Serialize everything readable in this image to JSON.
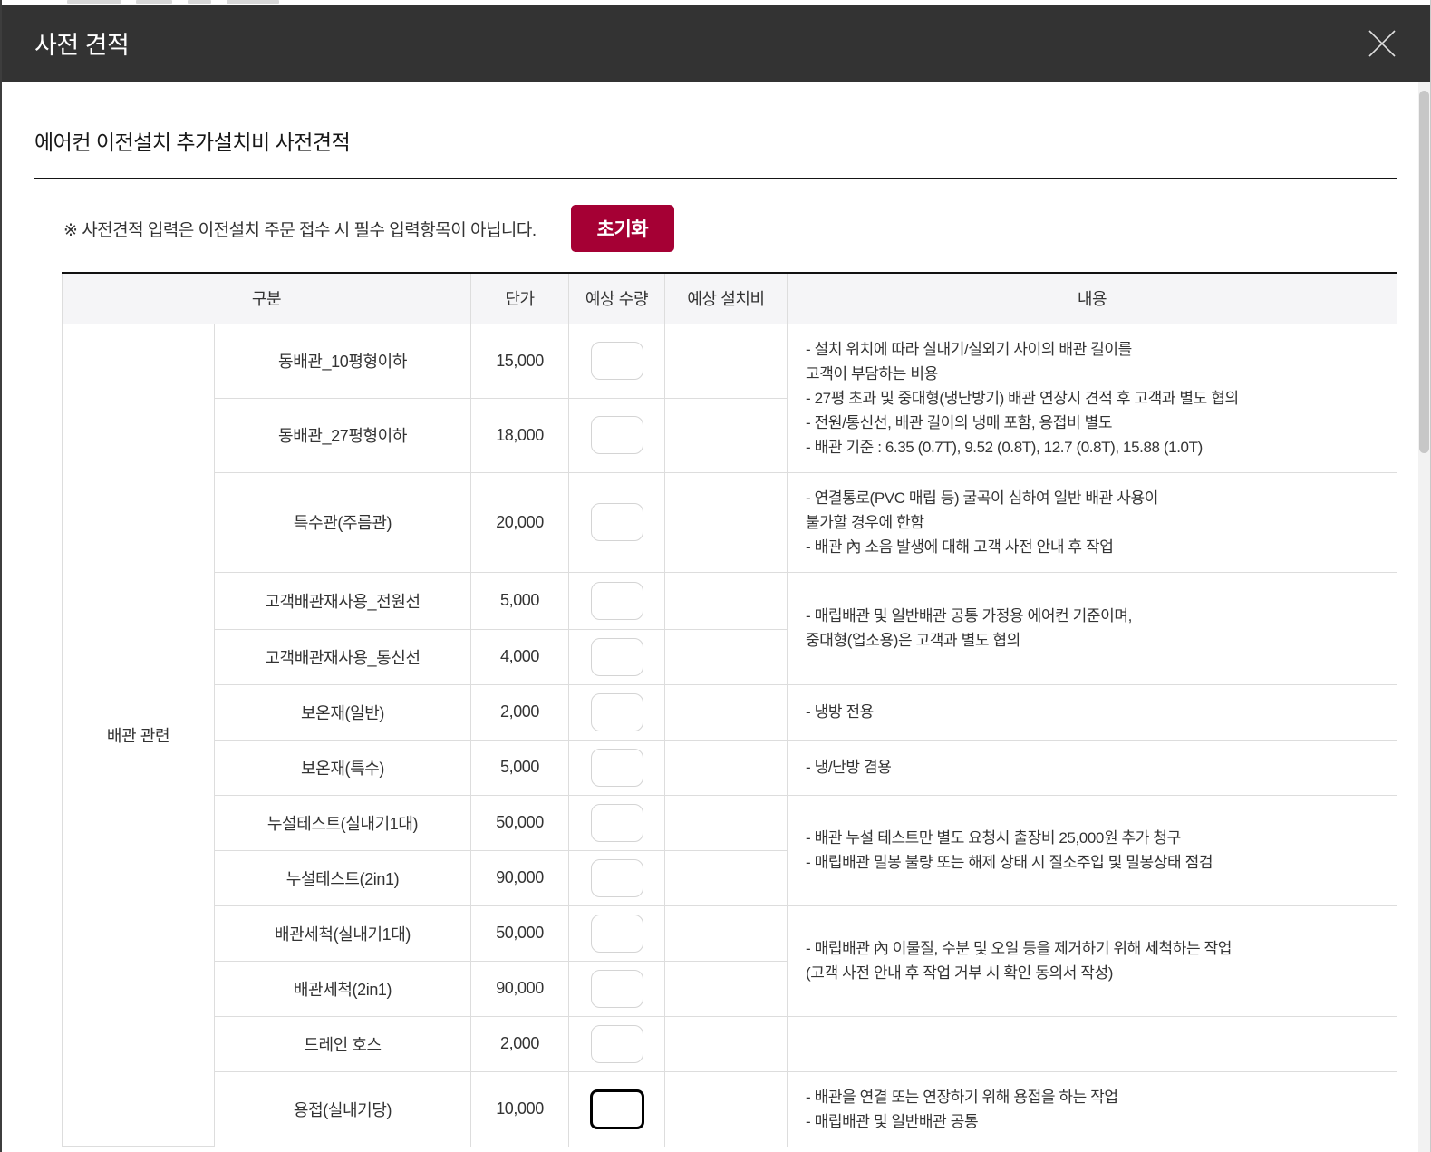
{
  "modal": {
    "title": "사전 견적",
    "close_icon": "x-icon"
  },
  "content": {
    "section_title": "에어컨 이전설치 추가설치비 사전견적",
    "note": "※ 사전견적 입력은 이전설치 주문 접수 시 필수 입력항목이 아닙니다.",
    "reset_button_label": "초기화"
  },
  "table": {
    "headers": {
      "category": "구분",
      "unit_price": "단가",
      "expected_quantity": "예상 수량",
      "expected_install_cost": "예상 설치비",
      "details": "내용"
    },
    "group_label": "배관 관련",
    "rows": [
      {
        "item": "동배관_10평형이하",
        "unit_price": "15,000",
        "quantity": "",
        "install_cost": ""
      },
      {
        "item": "동배관_27평형이하",
        "unit_price": "18,000",
        "quantity": "",
        "install_cost": ""
      },
      {
        "item": "특수관(주름관)",
        "unit_price": "20,000",
        "quantity": "",
        "install_cost": ""
      },
      {
        "item": "고객배관재사용_전원선",
        "unit_price": "5,000",
        "quantity": "",
        "install_cost": ""
      },
      {
        "item": "고객배관재사용_통신선",
        "unit_price": "4,000",
        "quantity": "",
        "install_cost": ""
      },
      {
        "item": "보온재(일반)",
        "unit_price": "2,000",
        "quantity": "",
        "install_cost": ""
      },
      {
        "item": "보온재(특수)",
        "unit_price": "5,000",
        "quantity": "",
        "install_cost": ""
      },
      {
        "item": "누설테스트(실내기1대)",
        "unit_price": "50,000",
        "quantity": "",
        "install_cost": ""
      },
      {
        "item": "누설테스트(2in1)",
        "unit_price": "90,000",
        "quantity": "",
        "install_cost": ""
      },
      {
        "item": "배관세척(실내기1대)",
        "unit_price": "50,000",
        "quantity": "",
        "install_cost": ""
      },
      {
        "item": "배관세척(2in1)",
        "unit_price": "90,000",
        "quantity": "",
        "install_cost": ""
      },
      {
        "item": "드레인 호스",
        "unit_price": "2,000",
        "quantity": "",
        "install_cost": ""
      },
      {
        "item": "용접(실내기당)",
        "unit_price": "10,000",
        "quantity": "",
        "install_cost": ""
      }
    ],
    "details": {
      "copper_pipe": "- 설치 위치에 따라 실내기/실외기 사이의 배관 길이를\n고객이 부담하는 비용\n- 27평 초과 및 중대형(냉난방기) 배관 연장시 견적 후 고객과 별도 협의\n- 전원/통신선, 배관 길이의 냉매 포함, 용접비 별도\n- 배관 기준 : 6.35 (0.7T), 9.52 (0.8T), 12.7 (0.8T), 15.88 (1.0T)",
      "special_pipe": "- 연결통로(PVC 매립 등) 굴곡이 심하여 일반 배관 사용이\n불가할 경우에 한함\n- 배관 內 소음 발생에 대해 고객 사전 안내 후 작업",
      "pipe_reuse": "- 매립배관 및 일반배관 공통 가정용 에어컨 기준이며,\n중대형(업소용)은 고객과 별도 협의",
      "insulation_normal": "- 냉방 전용",
      "insulation_special": "- 냉/난방 겸용",
      "leak_test": "- 배관 누설 테스트만 별도 요청시 출장비 25,000원 추가 청구\n- 매립배관 밀봉 불량 또는 해제 상태 시 질소주입 및 밀봉상태 점검",
      "pipe_cleaning": "- 매립배관 內 이물질, 수분 및 오일 등을 제거하기 위해 세척하는 작업\n(고객 사전 안내 후 작업 거부 시 확인 동의서 작성)",
      "drain_hose": "",
      "welding": "- 배관을 연결 또는 연장하기 위해 용접을 하는 작업\n- 매립배관 및 일반배관 공통"
    }
  },
  "colors": {
    "accent": "#a50034",
    "header_bar": "#333333",
    "table_header_bg": "#f5f5f7",
    "border": "#dddddd"
  }
}
